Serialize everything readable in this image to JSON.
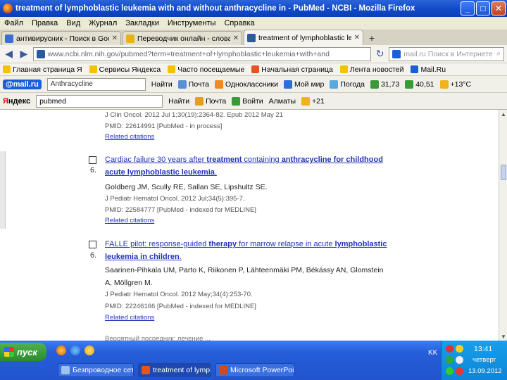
{
  "window": {
    "title": "treatment of lymphoblastic leukemia with and without anthracycline in - PubMed - NCBI - Mozilla Firefox",
    "buttons": [
      "_",
      "□",
      "✕"
    ]
  },
  "menu": [
    "Файл",
    "Правка",
    "Вид",
    "Журнал",
    "Закладки",
    "Инструменты",
    "Справка"
  ],
  "tabs": [
    {
      "label": "антивирусник - Поиск в Google",
      "active": false
    },
    {
      "label": "Переводчик онлайн - словарь от PRO...",
      "active": false
    },
    {
      "label": "treatment of lymphoblastic leukemia with...",
      "active": true
    }
  ],
  "nav": {
    "url": "www.ncbi.nlm.nih.gov/pubmed?term=treatment+of+lymphoblastic+leukemia+with+and",
    "search_placeholder": "mail.ru Поиск в Интернете"
  },
  "bookmarks": [
    "Главная страница Я",
    "Сервисы Яндекса",
    "Часто посещаемые",
    "Начальная страница",
    "Лента новостей",
    "Mail.Ru"
  ],
  "mailbar": {
    "logo": "@mail.ru",
    "query": "Anthracycline",
    "find": "Найти",
    "items": [
      "Почта",
      "Одноклассники",
      "Мой мир",
      "Погода",
      "31,73",
      "40,51",
      "+13°C"
    ]
  },
  "yabar": {
    "logo_prefix": "Я",
    "logo_rest": "ндекс",
    "query": "pubmed",
    "find": "Найти",
    "items": [
      "Почта",
      "Войти",
      "Алматы",
      "+21"
    ]
  },
  "results": {
    "prev_citation": "J Clin Oncol. 2012 Jul 1;30(19):2364-82. Epub 2012 May 21",
    "prev_pmid": "PMID: 22614991 [PubMed - in process]",
    "related": "Related citations",
    "items": [
      {
        "num": "6.",
        "title_line1_pre": "Cardiac failure 30 years after ",
        "title_line1_bold1": "treatment",
        "title_line1_mid": " containing ",
        "title_line1_bold2": "anthracycline for childhood",
        "title_line2_bold": "acute lymphoblastic leukemia",
        "title_line2_post": ".",
        "authors": "Goldberg JM, Scully RE, Sallan SE, Lipshultz SE.",
        "citation": "J Pediatr Hematol Oncol. 2012 Jul;34(5):395-7.",
        "pmid": "PMID: 22584777 [PubMed - indexed for MEDLINE]",
        "related": "Related citations"
      },
      {
        "num": "6.",
        "title_line1_pre": "FALLE pilot: response-guided ",
        "title_line1_bold1": "therapy",
        "title_line1_mid": " for marrow relapse in acute ",
        "title_line1_bold2": "lymphoblastic",
        "title_line2_bold": "leukemia in children",
        "title_line2_post": ".",
        "authors": "Saarinen-Pihkala UM, Parto K, Riikonen P, Lähteenmäki PM, Békássy AN, Glomstein",
        "authors2": "A, Möllgren M.",
        "citation": "J Pediatr Hematol Oncol. 2012 May;34(4):253-70.",
        "pmid": "PMID: 22246166 [PubMed - indexed for MEDLINE]",
        "related": "Related citations"
      }
    ],
    "cut_off": "Вероятный посредник: лечение ..."
  },
  "taskbar": {
    "start": "пуск",
    "buttons": [
      {
        "label": "Безпроводное сетев...",
        "active": false
      },
      {
        "label": "treatment of lymph...",
        "active": true
      },
      {
        "label": "Microsoft PowerPoint ...",
        "active": false
      }
    ],
    "lang": "KK",
    "time": "13:41",
    "day": "четверг",
    "date": "13.09.2012"
  }
}
